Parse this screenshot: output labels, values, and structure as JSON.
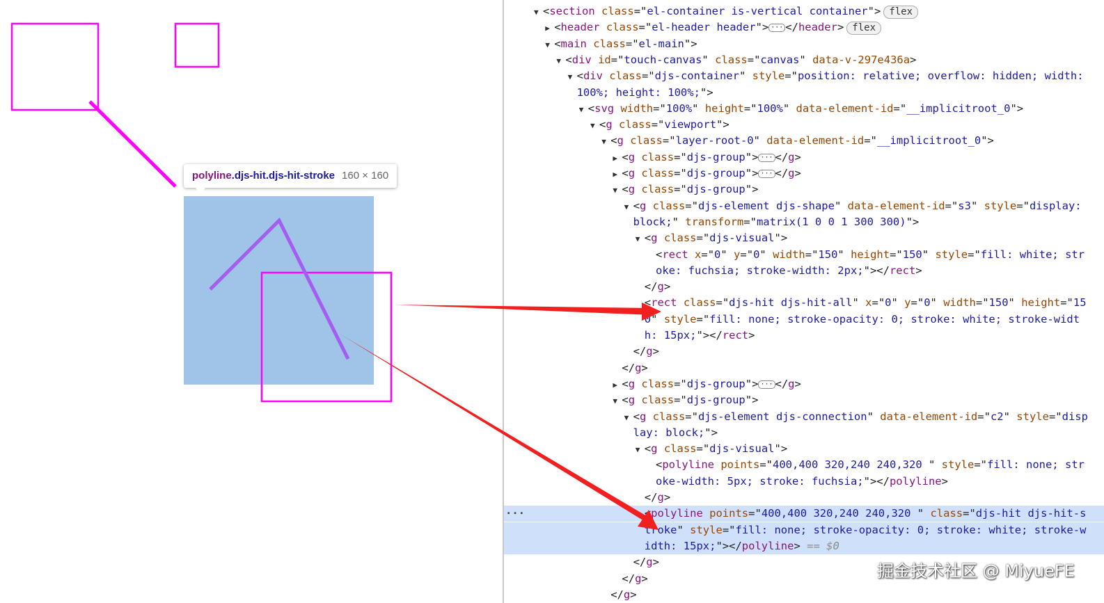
{
  "tooltip": {
    "tag": "polyline",
    "classes": ".djs-hit.djs-hit-stroke",
    "size": "160 × 160"
  },
  "colors": {
    "shape_stroke": "#ff00ff",
    "highlight": "#9fc4e8",
    "annotation_arrow": "#f02020",
    "selected_row": "#cfe0fb"
  },
  "dom_tree": [
    {
      "indent": 0,
      "tri": "down",
      "parts": [
        [
          "p",
          "<"
        ],
        [
          "t",
          "section"
        ],
        [
          "p",
          " "
        ],
        [
          "a",
          "class"
        ],
        [
          "p",
          "=\""
        ],
        [
          "v",
          "el-container is-vertical container"
        ],
        [
          "p",
          "\">"
        ]
      ],
      "badge": "flex"
    },
    {
      "indent": 1,
      "tri": "right",
      "parts": [
        [
          "p",
          "<"
        ],
        [
          "t",
          "header"
        ],
        [
          "p",
          " "
        ],
        [
          "a",
          "class"
        ],
        [
          "p",
          "=\""
        ],
        [
          "v",
          "el-header header"
        ],
        [
          "p",
          "\">"
        ]
      ],
      "ellipsis": true,
      "after": [
        [
          "p",
          "</"
        ],
        [
          "t",
          "header"
        ],
        [
          "p",
          ">"
        ]
      ],
      "badge": "flex"
    },
    {
      "indent": 1,
      "tri": "down",
      "parts": [
        [
          "p",
          "<"
        ],
        [
          "t",
          "main"
        ],
        [
          "p",
          " "
        ],
        [
          "a",
          "class"
        ],
        [
          "p",
          "=\""
        ],
        [
          "v",
          "el-main"
        ],
        [
          "p",
          "\">"
        ]
      ]
    },
    {
      "indent": 2,
      "tri": "down",
      "parts": [
        [
          "p",
          "<"
        ],
        [
          "t",
          "div"
        ],
        [
          "p",
          " "
        ],
        [
          "a",
          "id"
        ],
        [
          "p",
          "=\""
        ],
        [
          "v",
          "touch-canvas"
        ],
        [
          "p",
          "\" "
        ],
        [
          "a",
          "class"
        ],
        [
          "p",
          "=\""
        ],
        [
          "v",
          "canvas"
        ],
        [
          "p",
          "\" "
        ],
        [
          "a",
          "data-v-297e436a"
        ],
        [
          "p",
          ">"
        ]
      ]
    },
    {
      "indent": 3,
      "tri": "down",
      "parts": [
        [
          "p",
          "<"
        ],
        [
          "t",
          "div"
        ],
        [
          "p",
          " "
        ],
        [
          "a",
          "class"
        ],
        [
          "p",
          "=\""
        ],
        [
          "v",
          "djs-container"
        ],
        [
          "p",
          "\" "
        ],
        [
          "a",
          "style"
        ],
        [
          "p",
          "=\""
        ],
        [
          "v",
          "position: relative; overflow: hidden; width:"
        ]
      ]
    },
    {
      "indent": 3,
      "tri": "",
      "cont": true,
      "parts": [
        [
          "v",
          "100%; height: 100%;"
        ],
        [
          "p",
          "\">"
        ]
      ]
    },
    {
      "indent": 4,
      "tri": "down",
      "parts": [
        [
          "p",
          "<"
        ],
        [
          "t",
          "svg"
        ],
        [
          "p",
          " "
        ],
        [
          "a",
          "width"
        ],
        [
          "p",
          "=\""
        ],
        [
          "v",
          "100%"
        ],
        [
          "p",
          "\" "
        ],
        [
          "a",
          "height"
        ],
        [
          "p",
          "=\""
        ],
        [
          "v",
          "100%"
        ],
        [
          "p",
          "\" "
        ],
        [
          "a",
          "data-element-id"
        ],
        [
          "p",
          "=\""
        ],
        [
          "v",
          "__implicitroot_0"
        ],
        [
          "p",
          "\">"
        ]
      ]
    },
    {
      "indent": 5,
      "tri": "down",
      "parts": [
        [
          "p",
          "<"
        ],
        [
          "t",
          "g"
        ],
        [
          "p",
          " "
        ],
        [
          "a",
          "class"
        ],
        [
          "p",
          "=\""
        ],
        [
          "v",
          "viewport"
        ],
        [
          "p",
          "\">"
        ]
      ]
    },
    {
      "indent": 6,
      "tri": "down",
      "parts": [
        [
          "p",
          "<"
        ],
        [
          "t",
          "g"
        ],
        [
          "p",
          " "
        ],
        [
          "a",
          "class"
        ],
        [
          "p",
          "=\""
        ],
        [
          "v",
          "layer-root-0"
        ],
        [
          "p",
          "\" "
        ],
        [
          "a",
          "data-element-id"
        ],
        [
          "p",
          "=\""
        ],
        [
          "v",
          "__implicitroot_0"
        ],
        [
          "p",
          "\">"
        ]
      ]
    },
    {
      "indent": 7,
      "tri": "right",
      "parts": [
        [
          "p",
          "<"
        ],
        [
          "t",
          "g"
        ],
        [
          "p",
          " "
        ],
        [
          "a",
          "class"
        ],
        [
          "p",
          "=\""
        ],
        [
          "v",
          "djs-group"
        ],
        [
          "p",
          "\">"
        ]
      ],
      "ellipsis": true,
      "after": [
        [
          "p",
          "</"
        ],
        [
          "t",
          "g"
        ],
        [
          "p",
          ">"
        ]
      ]
    },
    {
      "indent": 7,
      "tri": "right",
      "parts": [
        [
          "p",
          "<"
        ],
        [
          "t",
          "g"
        ],
        [
          "p",
          " "
        ],
        [
          "a",
          "class"
        ],
        [
          "p",
          "=\""
        ],
        [
          "v",
          "djs-group"
        ],
        [
          "p",
          "\">"
        ]
      ],
      "ellipsis": true,
      "after": [
        [
          "p",
          "</"
        ],
        [
          "t",
          "g"
        ],
        [
          "p",
          ">"
        ]
      ]
    },
    {
      "indent": 7,
      "tri": "down",
      "parts": [
        [
          "p",
          "<"
        ],
        [
          "t",
          "g"
        ],
        [
          "p",
          " "
        ],
        [
          "a",
          "class"
        ],
        [
          "p",
          "=\""
        ],
        [
          "v",
          "djs-group"
        ],
        [
          "p",
          "\">"
        ]
      ]
    },
    {
      "indent": 8,
      "tri": "down",
      "parts": [
        [
          "p",
          "<"
        ],
        [
          "t",
          "g"
        ],
        [
          "p",
          " "
        ],
        [
          "a",
          "class"
        ],
        [
          "p",
          "=\""
        ],
        [
          "v",
          "djs-element djs-shape"
        ],
        [
          "p",
          "\" "
        ],
        [
          "a",
          "data-element-id"
        ],
        [
          "p",
          "=\""
        ],
        [
          "v",
          "s3"
        ],
        [
          "p",
          "\" "
        ],
        [
          "a",
          "style"
        ],
        [
          "p",
          "=\""
        ],
        [
          "v",
          "display:"
        ]
      ]
    },
    {
      "indent": 8,
      "tri": "",
      "cont": true,
      "parts": [
        [
          "v",
          "block;"
        ],
        [
          "p",
          "\" "
        ],
        [
          "a",
          "transform"
        ],
        [
          "p",
          "=\""
        ],
        [
          "v",
          "matrix(1 0 0 1 300 300)"
        ],
        [
          "p",
          "\">"
        ]
      ]
    },
    {
      "indent": 9,
      "tri": "down",
      "parts": [
        [
          "p",
          "<"
        ],
        [
          "t",
          "g"
        ],
        [
          "p",
          " "
        ],
        [
          "a",
          "class"
        ],
        [
          "p",
          "=\""
        ],
        [
          "v",
          "djs-visual"
        ],
        [
          "p",
          "\">"
        ]
      ]
    },
    {
      "indent": 10,
      "tri": "",
      "parts": [
        [
          "p",
          "<"
        ],
        [
          "t",
          "rect"
        ],
        [
          "p",
          " "
        ],
        [
          "a",
          "x"
        ],
        [
          "p",
          "=\""
        ],
        [
          "v",
          "0"
        ],
        [
          "p",
          "\" "
        ],
        [
          "a",
          "y"
        ],
        [
          "p",
          "=\""
        ],
        [
          "v",
          "0"
        ],
        [
          "p",
          "\" "
        ],
        [
          "a",
          "width"
        ],
        [
          "p",
          "=\""
        ],
        [
          "v",
          "150"
        ],
        [
          "p",
          "\" "
        ],
        [
          "a",
          "height"
        ],
        [
          "p",
          "=\""
        ],
        [
          "v",
          "150"
        ],
        [
          "p",
          "\" "
        ],
        [
          "a",
          "style"
        ],
        [
          "p",
          "=\""
        ],
        [
          "v",
          "fill: white; str"
        ]
      ]
    },
    {
      "indent": 10,
      "tri": "",
      "parts": [
        [
          "v",
          "oke: fuchsia; stroke-width: 2px;"
        ],
        [
          "p",
          "\"></"
        ],
        [
          "t",
          "rect"
        ],
        [
          "p",
          ">"
        ]
      ]
    },
    {
      "indent": 9,
      "tri": "",
      "parts": [
        [
          "p",
          "</"
        ],
        [
          "t",
          "g"
        ],
        [
          "p",
          ">"
        ]
      ]
    },
    {
      "indent": 9,
      "tri": "",
      "parts": [
        [
          "p",
          "<"
        ],
        [
          "t",
          "rect"
        ],
        [
          "p",
          " "
        ],
        [
          "a",
          "class"
        ],
        [
          "p",
          "=\""
        ],
        [
          "v",
          "djs-hit djs-hit-all"
        ],
        [
          "p",
          "\" "
        ],
        [
          "a",
          "x"
        ],
        [
          "p",
          "=\""
        ],
        [
          "v",
          "0"
        ],
        [
          "p",
          "\" "
        ],
        [
          "a",
          "y"
        ],
        [
          "p",
          "=\""
        ],
        [
          "v",
          "0"
        ],
        [
          "p",
          "\" "
        ],
        [
          "a",
          "width"
        ],
        [
          "p",
          "=\""
        ],
        [
          "v",
          "150"
        ],
        [
          "p",
          "\" "
        ],
        [
          "a",
          "height"
        ],
        [
          "p",
          "=\""
        ],
        [
          "v",
          "15"
        ]
      ]
    },
    {
      "indent": 9,
      "tri": "",
      "parts": [
        [
          "v",
          "0"
        ],
        [
          "p",
          "\" "
        ],
        [
          "a",
          "style"
        ],
        [
          "p",
          "=\""
        ],
        [
          "v",
          "fill: none; stroke-opacity: 0; stroke: white; stroke-widt"
        ]
      ]
    },
    {
      "indent": 9,
      "tri": "",
      "parts": [
        [
          "v",
          "h: 15px;"
        ],
        [
          "p",
          "\"></"
        ],
        [
          "t",
          "rect"
        ],
        [
          "p",
          ">"
        ]
      ]
    },
    {
      "indent": 8,
      "tri": "",
      "parts": [
        [
          "p",
          "</"
        ],
        [
          "t",
          "g"
        ],
        [
          "p",
          ">"
        ]
      ]
    },
    {
      "indent": 7,
      "tri": "",
      "parts": [
        [
          "p",
          "</"
        ],
        [
          "t",
          "g"
        ],
        [
          "p",
          ">"
        ]
      ]
    },
    {
      "indent": 7,
      "tri": "right",
      "parts": [
        [
          "p",
          "<"
        ],
        [
          "t",
          "g"
        ],
        [
          "p",
          " "
        ],
        [
          "a",
          "class"
        ],
        [
          "p",
          "=\""
        ],
        [
          "v",
          "djs-group"
        ],
        [
          "p",
          "\">"
        ]
      ],
      "ellipsis": true,
      "after": [
        [
          "p",
          "</"
        ],
        [
          "t",
          "g"
        ],
        [
          "p",
          ">"
        ]
      ]
    },
    {
      "indent": 7,
      "tri": "down",
      "parts": [
        [
          "p",
          "<"
        ],
        [
          "t",
          "g"
        ],
        [
          "p",
          " "
        ],
        [
          "a",
          "class"
        ],
        [
          "p",
          "=\""
        ],
        [
          "v",
          "djs-group"
        ],
        [
          "p",
          "\">"
        ]
      ]
    },
    {
      "indent": 8,
      "tri": "down",
      "parts": [
        [
          "p",
          "<"
        ],
        [
          "t",
          "g"
        ],
        [
          "p",
          " "
        ],
        [
          "a",
          "class"
        ],
        [
          "p",
          "=\""
        ],
        [
          "v",
          "djs-element djs-connection"
        ],
        [
          "p",
          "\" "
        ],
        [
          "a",
          "data-element-id"
        ],
        [
          "p",
          "=\""
        ],
        [
          "v",
          "c2"
        ],
        [
          "p",
          "\" "
        ],
        [
          "a",
          "style"
        ],
        [
          "p",
          "=\""
        ],
        [
          "v",
          "disp"
        ]
      ]
    },
    {
      "indent": 8,
      "tri": "",
      "cont": true,
      "parts": [
        [
          "v",
          "lay: block;"
        ],
        [
          "p",
          "\">"
        ]
      ]
    },
    {
      "indent": 9,
      "tri": "down",
      "parts": [
        [
          "p",
          "<"
        ],
        [
          "t",
          "g"
        ],
        [
          "p",
          " "
        ],
        [
          "a",
          "class"
        ],
        [
          "p",
          "=\""
        ],
        [
          "v",
          "djs-visual"
        ],
        [
          "p",
          "\">"
        ]
      ]
    },
    {
      "indent": 10,
      "tri": "",
      "parts": [
        [
          "p",
          "<"
        ],
        [
          "t",
          "polyline"
        ],
        [
          "p",
          " "
        ],
        [
          "a",
          "points"
        ],
        [
          "p",
          "=\""
        ],
        [
          "v",
          "400,400 320,240 240,320 "
        ],
        [
          "p",
          "\" "
        ],
        [
          "a",
          "style"
        ],
        [
          "p",
          "=\""
        ],
        [
          "v",
          "fill: none; str"
        ]
      ]
    },
    {
      "indent": 10,
      "tri": "",
      "parts": [
        [
          "v",
          "oke-width: 5px; stroke: fuchsia;"
        ],
        [
          "p",
          "\"></"
        ],
        [
          "t",
          "polyline"
        ],
        [
          "p",
          ">"
        ]
      ]
    },
    {
      "indent": 9,
      "tri": "",
      "parts": [
        [
          "p",
          "</"
        ],
        [
          "t",
          "g"
        ],
        [
          "p",
          ">"
        ]
      ]
    },
    {
      "indent": 9,
      "tri": "",
      "selected": true,
      "dots": true,
      "parts": [
        [
          "p",
          "<"
        ],
        [
          "t",
          "polyline"
        ],
        [
          "p",
          " "
        ],
        [
          "a",
          "points"
        ],
        [
          "p",
          "=\""
        ],
        [
          "v",
          "400,400 320,240 240,320 "
        ],
        [
          "p",
          "\" "
        ],
        [
          "a",
          "class"
        ],
        [
          "p",
          "=\""
        ],
        [
          "v",
          "djs-hit djs-hit-s"
        ]
      ]
    },
    {
      "indent": 9,
      "tri": "",
      "selected": true,
      "parts": [
        [
          "v",
          "troke"
        ],
        [
          "p",
          "\" "
        ],
        [
          "a",
          "style"
        ],
        [
          "p",
          "=\""
        ],
        [
          "v",
          "fill: none; stroke-opacity: 0; stroke: white; stroke-w"
        ]
      ]
    },
    {
      "indent": 9,
      "tri": "",
      "selected": true,
      "parts": [
        [
          "v",
          "idth: 15px;"
        ],
        [
          "p",
          "\"></"
        ],
        [
          "t",
          "polyline"
        ],
        [
          "p",
          ">"
        ]
      ],
      "dollar": " == $0"
    },
    {
      "indent": 8,
      "tri": "",
      "parts": [
        [
          "p",
          "</"
        ],
        [
          "t",
          "g"
        ],
        [
          "p",
          ">"
        ]
      ]
    },
    {
      "indent": 7,
      "tri": "",
      "parts": [
        [
          "p",
          "</"
        ],
        [
          "t",
          "g"
        ],
        [
          "p",
          ">"
        ]
      ]
    },
    {
      "indent": 6,
      "tri": "",
      "parts": [
        [
          "p",
          "</"
        ],
        [
          "t",
          "g"
        ],
        [
          "p",
          ">"
        ]
      ]
    }
  ],
  "watermark": "掘金技术社区 @ MiyueFE"
}
